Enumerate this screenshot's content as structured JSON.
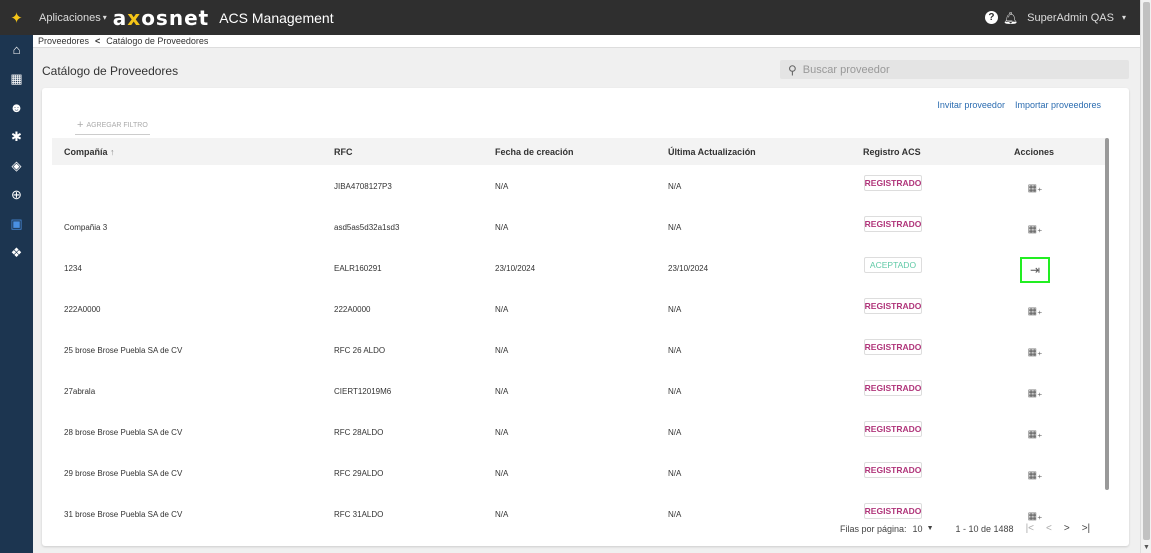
{
  "topbar": {
    "apps_label": "Aplicaciones",
    "apps_caret": "▾",
    "brand_a": "a",
    "brand_x": "x",
    "brand_rest": "osnet",
    "app_title": "ACS Management",
    "help": "?",
    "user": "SuperAdmin QAS",
    "user_caret": "▾",
    "logo_icon": "sparkle-icon"
  },
  "sidebar": {
    "items": [
      {
        "icon": "home-icon",
        "glyph": "⌂"
      },
      {
        "icon": "building-icon",
        "glyph": "▦"
      },
      {
        "icon": "users-icon",
        "glyph": "☻"
      },
      {
        "icon": "gear-icon",
        "glyph": "✱"
      },
      {
        "icon": "layers-icon",
        "glyph": "◈"
      },
      {
        "icon": "globe-icon",
        "glyph": "⊕"
      },
      {
        "icon": "clipboard-icon",
        "glyph": "▣",
        "active": true
      },
      {
        "icon": "handshake-icon",
        "glyph": "❖"
      }
    ]
  },
  "breadcrumb": {
    "first": "Proveedores",
    "sep": "<",
    "second": "Catálogo de Proveedores"
  },
  "page": {
    "title": "Catálogo de Proveedores",
    "search_placeholder": "Buscar proveedor"
  },
  "card": {
    "invite": "Invitar proveedor",
    "import": "Importar proveedores",
    "add_filter": "AGREGAR FILTRO"
  },
  "table": {
    "headers": {
      "company": "Compañía",
      "company_sort": "↑",
      "rfc": "RFC",
      "created": "Fecha de creación",
      "updated": "Última Actualización",
      "registro": "Registro ACS",
      "actions": "Acciones"
    },
    "rows": [
      {
        "company": "",
        "rfc": "JIBA4708127P3",
        "created": "N/A",
        "updated": "N/A",
        "status": "REGISTRADO"
      },
      {
        "company": "Compañia 3",
        "rfc": "asd5as5d32a1sd3",
        "created": "N/A",
        "updated": "N/A",
        "status": "REGISTRADO"
      },
      {
        "company": "1234",
        "rfc": "EALR160291",
        "created": "23/10/2024",
        "updated": "23/10/2024",
        "status": "ACEPTADO"
      },
      {
        "company": "222A0000",
        "rfc": "222A0000",
        "created": "N/A",
        "updated": "N/A",
        "status": "REGISTRADO"
      },
      {
        "company": "25 brose Brose Puebla SA de CV",
        "rfc": "RFC 26 ALDO",
        "created": "N/A",
        "updated": "N/A",
        "status": "REGISTRADO"
      },
      {
        "company": "27abrala",
        "rfc": "CIERT12019M6",
        "created": "N/A",
        "updated": "N/A",
        "status": "REGISTRADO"
      },
      {
        "company": "28 brose Brose Puebla SA de CV",
        "rfc": "RFC 28ALDO",
        "created": "N/A",
        "updated": "N/A",
        "status": "REGISTRADO"
      },
      {
        "company": "29 brose Brose Puebla SA de CV",
        "rfc": "RFC 29ALDO",
        "created": "N/A",
        "updated": "N/A",
        "status": "REGISTRADO"
      },
      {
        "company": "31 brose Brose Puebla SA de CV",
        "rfc": "RFC 31ALDO",
        "created": "N/A",
        "updated": "N/A",
        "status": "REGISTRADO"
      }
    ]
  },
  "pagination": {
    "rows_label": "Filas por página:",
    "rows_value": "10",
    "range": "1 - 10 de 1488",
    "first": "|<",
    "prev": "<",
    "next": ">",
    "last": ">|"
  },
  "colors": {
    "registered": "#b0357a",
    "accepted": "#5fc9a6",
    "link": "#2b6cb0",
    "sidebar": "#1c3550",
    "highlight": "#22ee22"
  }
}
